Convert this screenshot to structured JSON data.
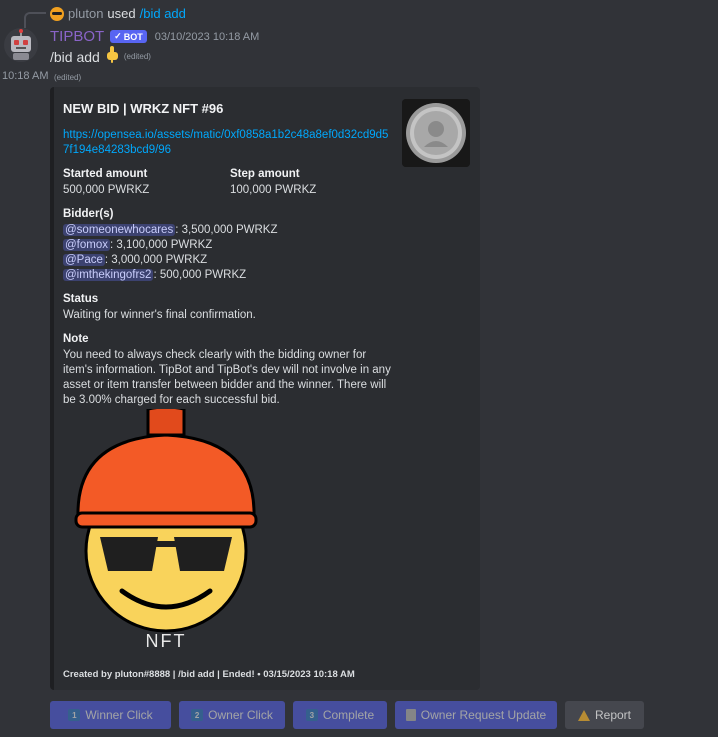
{
  "reply": {
    "user": "pluton",
    "used_text": "used",
    "command": "/bid add"
  },
  "message": {
    "username": "TIPBOT",
    "bot_tag": "BOT",
    "timestamp": "03/10/2023 10:18 AM",
    "side_time": "10:18 AM",
    "text": "/bid add",
    "edited": "(edited)"
  },
  "embed": {
    "title": "NEW BID | WRKZ NFT #96",
    "link": "https://opensea.io/assets/matic/0xf0858a1b2c48a8ef0d32cd9d57f194e84283bcd9/96",
    "fields": [
      {
        "name": "Started amount",
        "value": "500,000 PWRKZ"
      },
      {
        "name": "Step amount",
        "value": "100,000 PWRKZ"
      }
    ],
    "bidders_title": "Bidder(s)",
    "bidders": [
      {
        "mention": "@someonewhocares",
        "amount": ": 3,500,000 PWRKZ"
      },
      {
        "mention": "@fomox",
        "amount": ": 3,100,000 PWRKZ"
      },
      {
        "mention": "@Pace",
        "amount": ": 3,000,000 PWRKZ"
      },
      {
        "mention": "@imthekingofrs2",
        "amount": ": 500,000 PWRKZ"
      }
    ],
    "status_title": "Status",
    "status_text": "Waiting for winner's final confirmation.",
    "note_title": "Note",
    "note_text": "You need to always check clearly with the bidding owner for item's information. TipBot and TipBot's dev will not involve in any asset or item transfer between bidder and the winner. There will be 3.00% charged for each successful bid.",
    "image_caption": "NFT",
    "footer": "Created by pluton#8888 | /bid add | Ended! • 03/15/2023 10:18 AM"
  },
  "buttons": [
    {
      "icon": "1",
      "label": "Winner Click"
    },
    {
      "icon": "2",
      "label": "Owner Click"
    },
    {
      "icon": "3",
      "label": "Complete"
    },
    {
      "label": "Owner Request Update"
    },
    {
      "label": "Report"
    }
  ],
  "colors": {
    "username": "#8a64c8",
    "link": "#00a8fc",
    "blurple": "#5865f2",
    "background": "#313338",
    "embed_bg": "#2b2d31"
  }
}
